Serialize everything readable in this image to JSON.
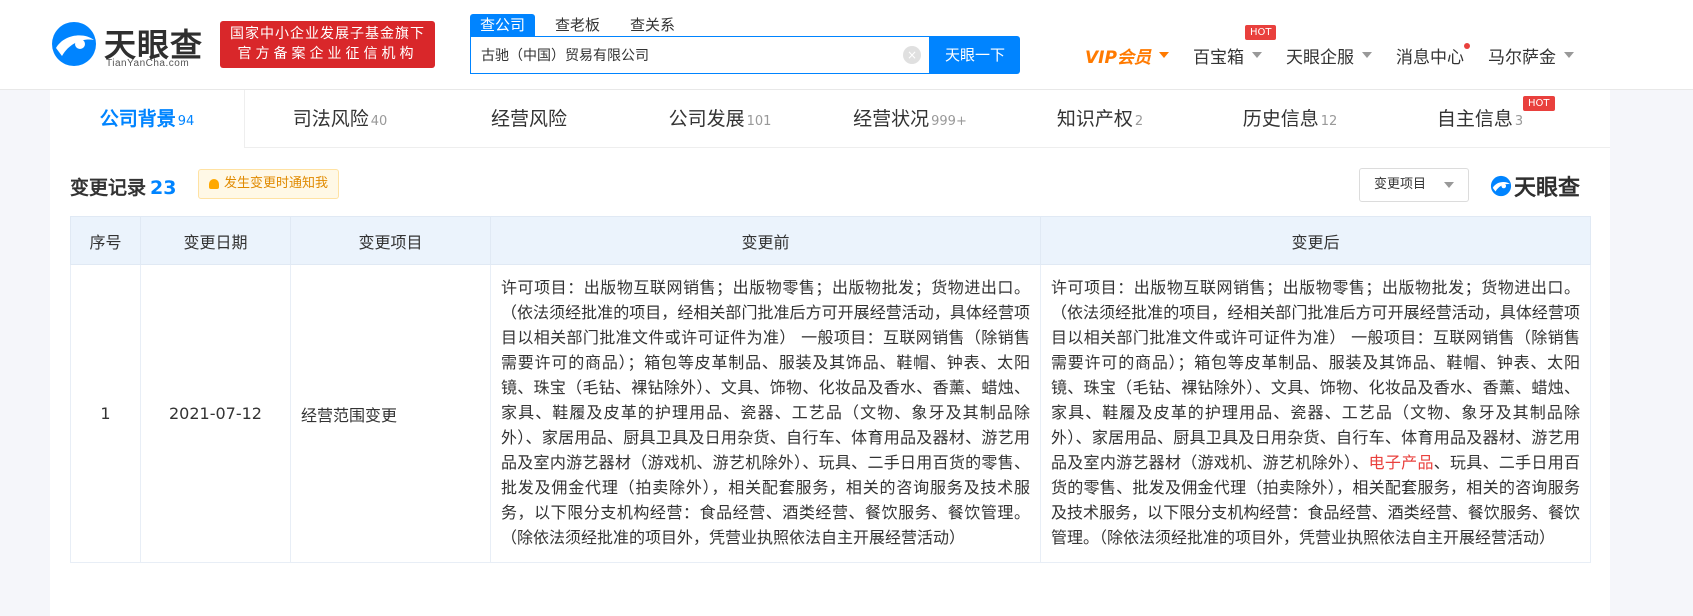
{
  "header": {
    "logo_text": "天眼查",
    "logo_domain": "TianYanCha.com",
    "gov_badge_line1": "国家中小企业发展子基金旗下",
    "gov_badge_line2": "官方备案企业征信机构",
    "search_tabs": [
      "查公司",
      "查老板",
      "查关系"
    ],
    "search_value": "古驰（中国）贸易有限公司",
    "clear_glyph": "×",
    "search_button": "天眼一下",
    "nav": {
      "vip": "VIP会员",
      "toolbox": "百宝箱",
      "toolbox_badge": "HOT",
      "enterprise": "天眼企服",
      "messages": "消息中心",
      "user": "马尔萨金"
    }
  },
  "tabs": [
    {
      "label": "公司背景",
      "count": "94"
    },
    {
      "label": "司法风险",
      "count": "40"
    },
    {
      "label": "经营风险",
      "count": ""
    },
    {
      "label": "公司发展",
      "count": "101"
    },
    {
      "label": "经营状况",
      "count": "999+"
    },
    {
      "label": "知识产权",
      "count": "2"
    },
    {
      "label": "历史信息",
      "count": "12"
    },
    {
      "label": "自主信息",
      "count": "3"
    }
  ],
  "tab_hot_badge": "HOT",
  "section": {
    "title": "变更记录",
    "count": "23",
    "notify_label": "发生变更时通知我",
    "filter_label": "变更项目",
    "watermark": "天眼查"
  },
  "table": {
    "headers": [
      "序号",
      "变更日期",
      "变更项目",
      "变更前",
      "变更后"
    ],
    "rows": [
      {
        "index": "1",
        "date": "2021-07-12",
        "item": "经营范围变更",
        "before": "许可项目：出版物互联网销售；出版物零售；出版物批发；货物进出口。（依法须经批准的项目，经相关部门批准后方可开展经营活动，具体经营项目以相关部门批准文件或许可证件为准） 一般项目：互联网销售（除销售需要许可的商品）；箱包等皮革制品、服装及其饰品、鞋帽、钟表、太阳镜、珠宝（毛钻、裸钻除外）、文具、饰物、化妆品及香水、香薰、蜡烛、家具、鞋履及皮革的护理用品、瓷器、工艺品（文物、象牙及其制品除外）、家居用品、厨具卫具及日用杂货、自行车、体育用品及器材、游艺用品及室内游艺器材（游戏机、游艺机除外）、玩具、二手日用百货的零售、批发及佣金代理（拍卖除外），相关配套服务，相关的咨询服务及技术服务，以下限分支机构经营：食品经营、酒类经营、餐饮服务、餐饮管理。（除依法须经批准的项目外，凭营业执照依法自主开展经营活动）",
        "after_part1": "许可项目：出版物互联网销售；出版物零售；出版物批发；货物进出口。（依法须经批准的项目，经相关部门批准后方可开展经营活动，具体经营项目以相关部门批准文件或许可证件为准） 一般项目：互联网销售（除销售需要许可的商品）；箱包等皮革制品、服装及其饰品、鞋帽、钟表、太阳镜、珠宝（毛钻、裸钻除外）、文具、饰物、化妆品及香水、香薰、蜡烛、家具、鞋履及皮革的护理用品、瓷器、工艺品（文物、象牙及其制品除外）、家居用品、厨具卫具及日用杂货、自行车、体育用品及器材、游艺用品及室内游艺器材（游戏机、游艺机除外）、",
        "after_highlight": "电子产品",
        "after_part2": "、玩具、二手日用百货的零售、批发及佣金代理（拍卖除外），相关配套服务，相关的咨询服务及技术服务，以下限分支机构经营：食品经营、酒类经营、餐饮服务、餐饮管理。（除依法须经批准的项目外，凭营业执照依法自主开展经营活动）"
      }
    ]
  },
  "colors": {
    "brand_blue": "#0084ff",
    "badge_red": "#d9272a",
    "hot_red": "#e9403d",
    "vip_orange": "#ff7a00"
  }
}
